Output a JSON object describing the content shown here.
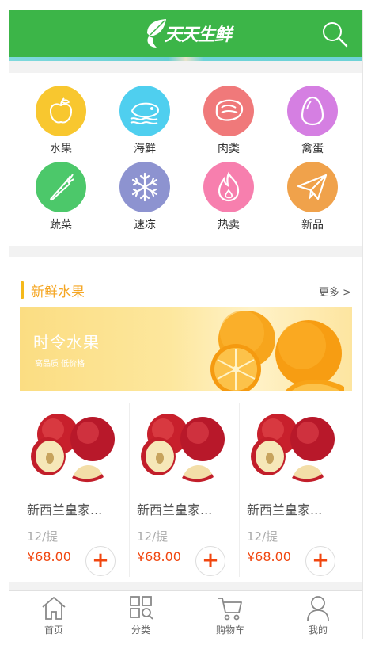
{
  "header": {
    "logo_text": "天天生鲜",
    "search_icon": "search-icon",
    "background_color": "#3cb548"
  },
  "categories": [
    {
      "label": "水果",
      "icon": "apple-icon",
      "color": "#f8c72f"
    },
    {
      "label": "海鲜",
      "icon": "fish-icon",
      "color": "#4fcfef"
    },
    {
      "label": "肉类",
      "icon": "meat-icon",
      "color": "#f0797a"
    },
    {
      "label": "禽蛋",
      "icon": "egg-icon",
      "color": "#d57fe2"
    },
    {
      "label": "蔬菜",
      "icon": "carrot-icon",
      "color": "#4cc86a"
    },
    {
      "label": "速冻",
      "icon": "snowflake-icon",
      "color": "#8d93d0"
    },
    {
      "label": "热卖",
      "icon": "flame-icon",
      "color": "#f77fae"
    },
    {
      "label": "新品",
      "icon": "paper-plane-icon",
      "color": "#f0a24b"
    }
  ],
  "section": {
    "title": "新鲜水果",
    "more": "更多 >",
    "accent_color": "#f5a623",
    "promo": {
      "title": "时令水果",
      "subtitle": "高品质 低价格",
      "image": "oranges-image"
    }
  },
  "products": [
    {
      "name": "新西兰皇家...",
      "unit": "12/提",
      "price": "¥68.00",
      "image": "apples-image",
      "add_icon": "plus-icon"
    },
    {
      "name": "新西兰皇家...",
      "unit": "12/提",
      "price": "¥68.00",
      "image": "apples-image",
      "add_icon": "plus-icon"
    },
    {
      "name": "新西兰皇家...",
      "unit": "12/提",
      "price": "¥68.00",
      "image": "apples-image",
      "add_icon": "plus-icon"
    }
  ],
  "tabbar": [
    {
      "label": "首页",
      "icon": "home-icon"
    },
    {
      "label": "分类",
      "icon": "category-icon"
    },
    {
      "label": "购物车",
      "icon": "cart-icon"
    },
    {
      "label": "我的",
      "icon": "user-icon"
    }
  ],
  "colors": {
    "price": "#f1460f",
    "page_bg": "#f2f2f2"
  }
}
